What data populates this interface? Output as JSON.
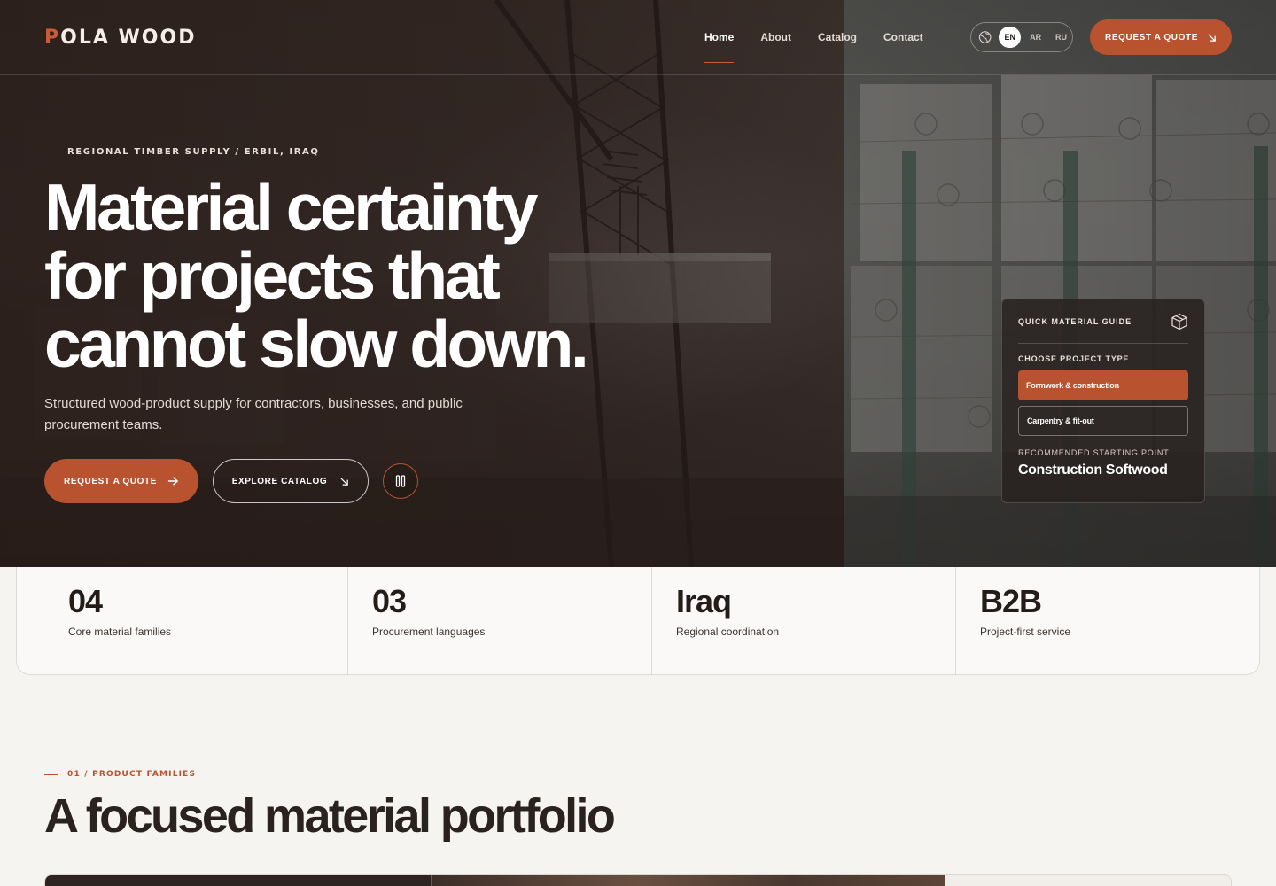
{
  "brand": {
    "logo_first": "P",
    "logo_rest": "OLA WOOD",
    "accent": "#b9522f"
  },
  "nav": {
    "items": [
      {
        "label": "Home",
        "active": true
      },
      {
        "label": "About"
      },
      {
        "label": "Catalog"
      },
      {
        "label": "Contact"
      }
    ]
  },
  "language": {
    "icon": "globe-icon",
    "options": [
      "EN",
      "AR",
      "RU"
    ],
    "selected": "EN"
  },
  "header_cta": {
    "label": "REQUEST A QUOTE",
    "icon": "arrow-down-right-icon"
  },
  "hero": {
    "eyebrow": "REGIONAL TIMBER SUPPLY / ERBIL, IRAQ",
    "headline_lines": [
      "Material certainty",
      "for projects that",
      "cannot slow down."
    ],
    "subtext": "Structured wood-product supply for contractors, businesses, and public procurement teams.",
    "primary_cta": {
      "label": "REQUEST A QUOTE",
      "icon": "arrow-right-icon"
    },
    "secondary_cta": {
      "label": "EXPLORE CATALOG",
      "icon": "arrow-down-right-icon"
    },
    "media_control": {
      "icon": "pause-icon"
    }
  },
  "guide": {
    "title": "QUICK MATERIAL GUIDE",
    "icon": "package-icon",
    "label": "CHOOSE PROJECT TYPE",
    "options": [
      {
        "label": "Formwork & construction",
        "selected": true
      },
      {
        "label": "Carpentry & fit-out",
        "selected": false
      }
    ],
    "recommended_label": "RECOMMENDED STARTING POINT",
    "recommended_value": "Construction Softwood"
  },
  "stats": [
    {
      "value": "04",
      "label": "Core material families"
    },
    {
      "value": "03",
      "label": "Procurement languages"
    },
    {
      "value": "Iraq",
      "label": "Regional coordination"
    },
    {
      "value": "B2B",
      "label": "Project-first service"
    }
  ],
  "section": {
    "eyebrow": "01 / PRODUCT FAMILIES",
    "title": "A focused material portfolio"
  }
}
